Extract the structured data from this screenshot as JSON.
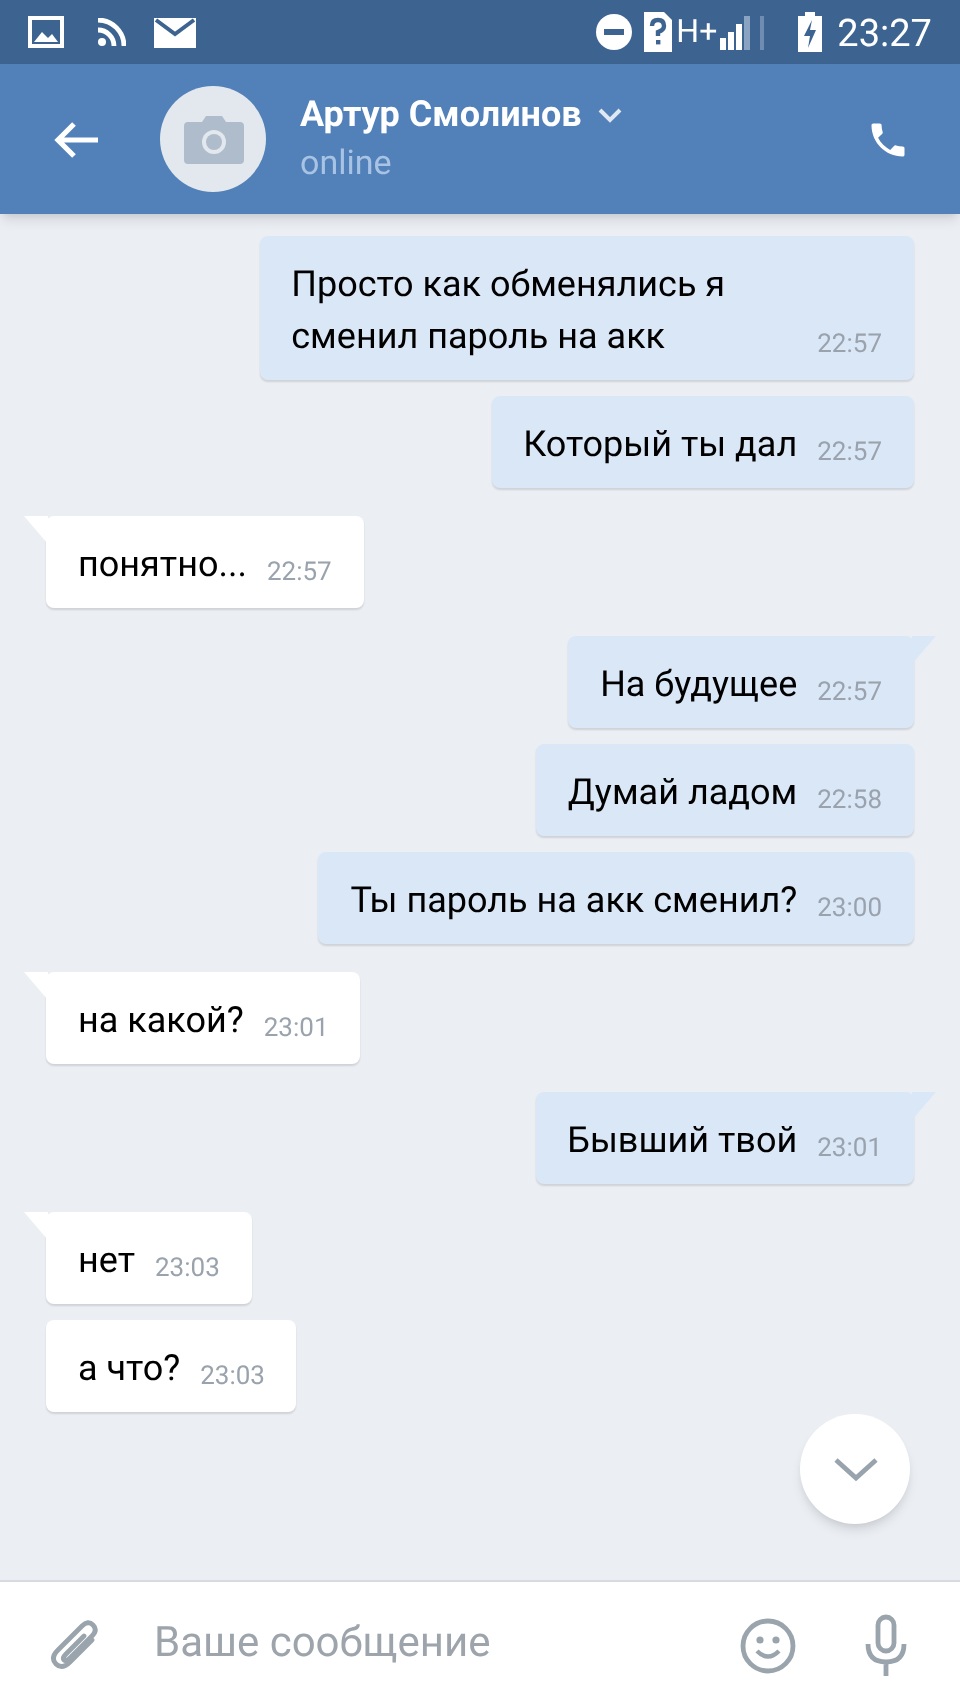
{
  "status_bar": {
    "network": "H+",
    "time": "23:27"
  },
  "header": {
    "name": "Артур Смолинов",
    "status": "online"
  },
  "messages": [
    {
      "text": "Просто как обменялись я сменил пароль на акк",
      "time": "22:57",
      "outgoing": true,
      "tail": false
    },
    {
      "text": "Который ты дал",
      "time": "22:57",
      "outgoing": true,
      "tail": false
    },
    {
      "text": "понятно...",
      "time": "22:57",
      "outgoing": false,
      "tail": true
    },
    {
      "text": "На будущее",
      "time": "22:57",
      "outgoing": true,
      "tail": true
    },
    {
      "text": "Думай ладом",
      "time": "22:58",
      "outgoing": true,
      "tail": false
    },
    {
      "text": "Ты пароль на акк сменил?",
      "time": "23:00",
      "outgoing": true,
      "tail": false
    },
    {
      "text": "на какой?",
      "time": "23:01",
      "outgoing": false,
      "tail": true
    },
    {
      "text": "Бывший твой",
      "time": "23:01",
      "outgoing": true,
      "tail": true
    },
    {
      "text": "нет",
      "time": "23:03",
      "outgoing": false,
      "tail": true
    },
    {
      "text": "а что?",
      "time": "23:03",
      "outgoing": false,
      "tail": false
    }
  ],
  "composer": {
    "placeholder": "Ваше сообщение"
  }
}
